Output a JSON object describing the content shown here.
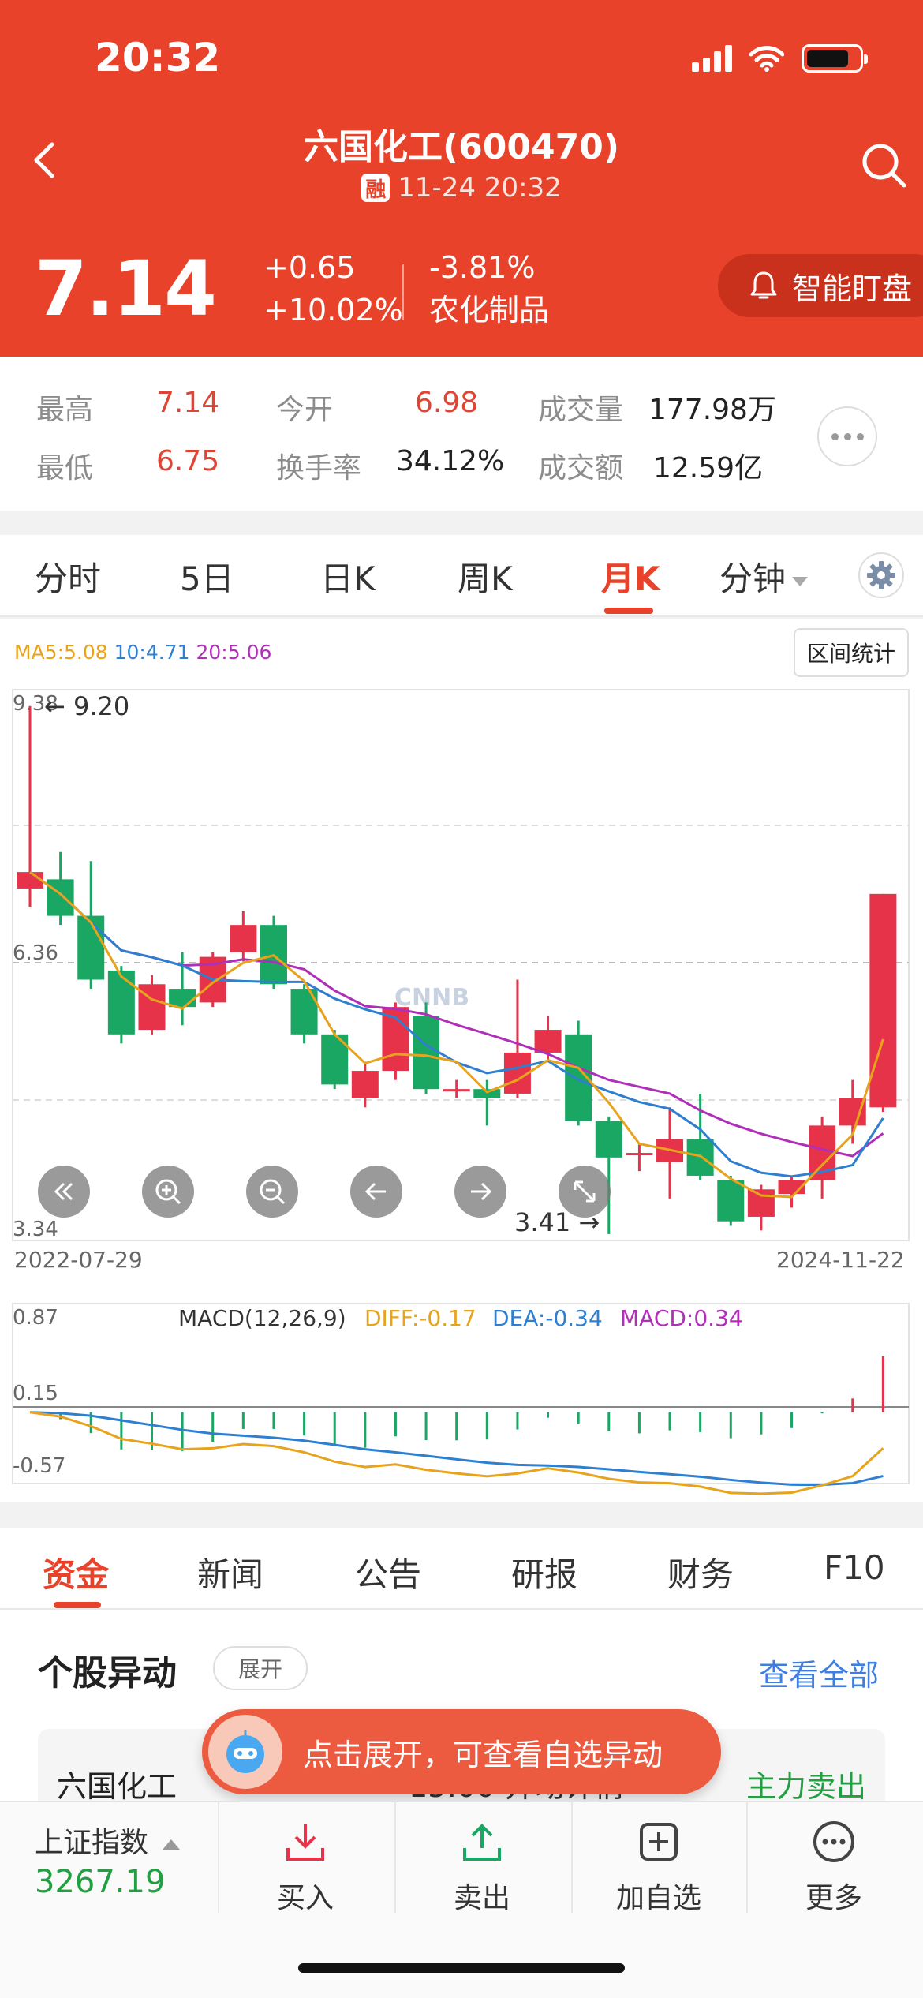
{
  "status_bar": {
    "time": "20:32"
  },
  "header": {
    "title": "六国化工(600470)",
    "badge": "融",
    "datetime": "11-24 20:32",
    "price": "7.14",
    "change": "+0.65",
    "change_pct": "+10.02%",
    "period_pct": "-3.81%",
    "sector": "农化制品",
    "smart_watch_label": "智能盯盘"
  },
  "quote": {
    "high_label": "最高",
    "high": "7.14",
    "open_label": "今开",
    "open": "6.98",
    "volume_label": "成交量",
    "volume": "177.98万",
    "low_label": "最低",
    "low": "6.75",
    "turnover_label": "换手率",
    "turnover": "34.12%",
    "amount_label": "成交额",
    "amount": "12.59亿"
  },
  "chart_tabs": [
    "分时",
    "5日",
    "日K",
    "周K",
    "月K",
    "分钟"
  ],
  "chart_tab_active": "月K",
  "chart": {
    "ma_labels": {
      "ma5": "MA5:5.08",
      "ma10": "10:4.71",
      "ma20": "20:5.06"
    },
    "range_stats_label": "区间统计",
    "y_top": "9.38",
    "y_mid": "6.36",
    "y_bottom": "3.34",
    "max_marker": "9.20",
    "min_marker": "3.41",
    "date_start": "2022-07-29",
    "date_end": "2024-11-22",
    "macd_title": "MACD(12,26,9)",
    "diff_label": "DIFF:-0.17",
    "dea_label": "DEA:-0.34",
    "macd_label": "MACD:0.34",
    "macd_top": "0.87",
    "macd_mid": "0.15",
    "macd_bottom": "-0.57",
    "watermark": "CNNB"
  },
  "colors": {
    "brand": "#e8432a",
    "up": "#e6334a",
    "down": "#1aa663",
    "ma5": "#e8a31c",
    "ma10": "#2f7fd1",
    "ma20": "#b02fb8"
  },
  "chart_data": {
    "type": "candlestick",
    "x_range": [
      "2022-07-29",
      "2024-11-22"
    ],
    "ylim": [
      3.34,
      9.38
    ],
    "candles": [
      {
        "o": 7.2,
        "c": 7.38,
        "h": 9.2,
        "l": 7.0
      },
      {
        "o": 7.3,
        "c": 6.9,
        "h": 7.6,
        "l": 6.8
      },
      {
        "o": 6.9,
        "c": 6.2,
        "h": 7.5,
        "l": 6.1
      },
      {
        "o": 6.3,
        "c": 5.6,
        "h": 6.35,
        "l": 5.5
      },
      {
        "o": 5.65,
        "c": 6.15,
        "h": 6.25,
        "l": 5.6
      },
      {
        "o": 6.1,
        "c": 5.9,
        "h": 6.5,
        "l": 5.7
      },
      {
        "o": 5.95,
        "c": 6.45,
        "h": 6.5,
        "l": 5.9
      },
      {
        "o": 6.5,
        "c": 6.8,
        "h": 6.95,
        "l": 6.4
      },
      {
        "o": 6.8,
        "c": 6.15,
        "h": 6.9,
        "l": 6.1
      },
      {
        "o": 6.1,
        "c": 5.6,
        "h": 6.15,
        "l": 5.5
      },
      {
        "o": 5.6,
        "c": 5.05,
        "h": 5.65,
        "l": 5.0
      },
      {
        "o": 4.9,
        "c": 5.2,
        "h": 5.3,
        "l": 4.8
      },
      {
        "o": 5.2,
        "c": 5.9,
        "h": 5.95,
        "l": 5.1
      },
      {
        "o": 5.8,
        "c": 5.0,
        "h": 5.95,
        "l": 4.95
      },
      {
        "o": 5.0,
        "c": 5.0,
        "h": 5.1,
        "l": 4.9
      },
      {
        "o": 5.0,
        "c": 4.9,
        "h": 5.1,
        "l": 4.6
      },
      {
        "o": 4.95,
        "c": 5.4,
        "h": 6.2,
        "l": 4.9
      },
      {
        "o": 5.4,
        "c": 5.65,
        "h": 5.8,
        "l": 5.3
      },
      {
        "o": 5.6,
        "c": 4.65,
        "h": 5.75,
        "l": 4.6
      },
      {
        "o": 4.65,
        "c": 4.25,
        "h": 4.7,
        "l": 3.41
      },
      {
        "o": 4.3,
        "c": 4.3,
        "h": 4.4,
        "l": 4.1
      },
      {
        "o": 4.2,
        "c": 4.45,
        "h": 4.8,
        "l": 3.8
      },
      {
        "o": 4.45,
        "c": 4.05,
        "h": 4.95,
        "l": 4.0
      },
      {
        "o": 4.0,
        "c": 3.55,
        "h": 4.05,
        "l": 3.5
      },
      {
        "o": 3.6,
        "c": 3.9,
        "h": 3.95,
        "l": 3.45
      },
      {
        "o": 3.85,
        "c": 4.0,
        "h": 4.05,
        "l": 3.7
      },
      {
        "o": 4.0,
        "c": 4.6,
        "h": 4.7,
        "l": 3.8
      },
      {
        "o": 4.6,
        "c": 4.9,
        "h": 5.1,
        "l": 4.4
      },
      {
        "o": 4.8,
        "c": 7.14,
        "h": 7.14,
        "l": 4.75
      }
    ],
    "macd_ylim": [
      -0.57,
      0.87
    ]
  },
  "bottom_tabs": [
    "资金",
    "新闻",
    "公告",
    "研报",
    "财务",
    "F10"
  ],
  "bottom_tab_active": "资金",
  "abnormal": {
    "title": "个股异动",
    "expand_label": "展开",
    "view_all_label": "查看全部",
    "row_name": "六国化工",
    "row_mid": "15:00   异动详情",
    "row_tag": "主力卖出"
  },
  "toast": {
    "text": "点击展开，可查看自选异动"
  },
  "bottom_bar": {
    "index_name": "上证指数",
    "index_value": "3267.19",
    "actions": [
      "买入",
      "卖出",
      "加自选",
      "更多"
    ]
  }
}
